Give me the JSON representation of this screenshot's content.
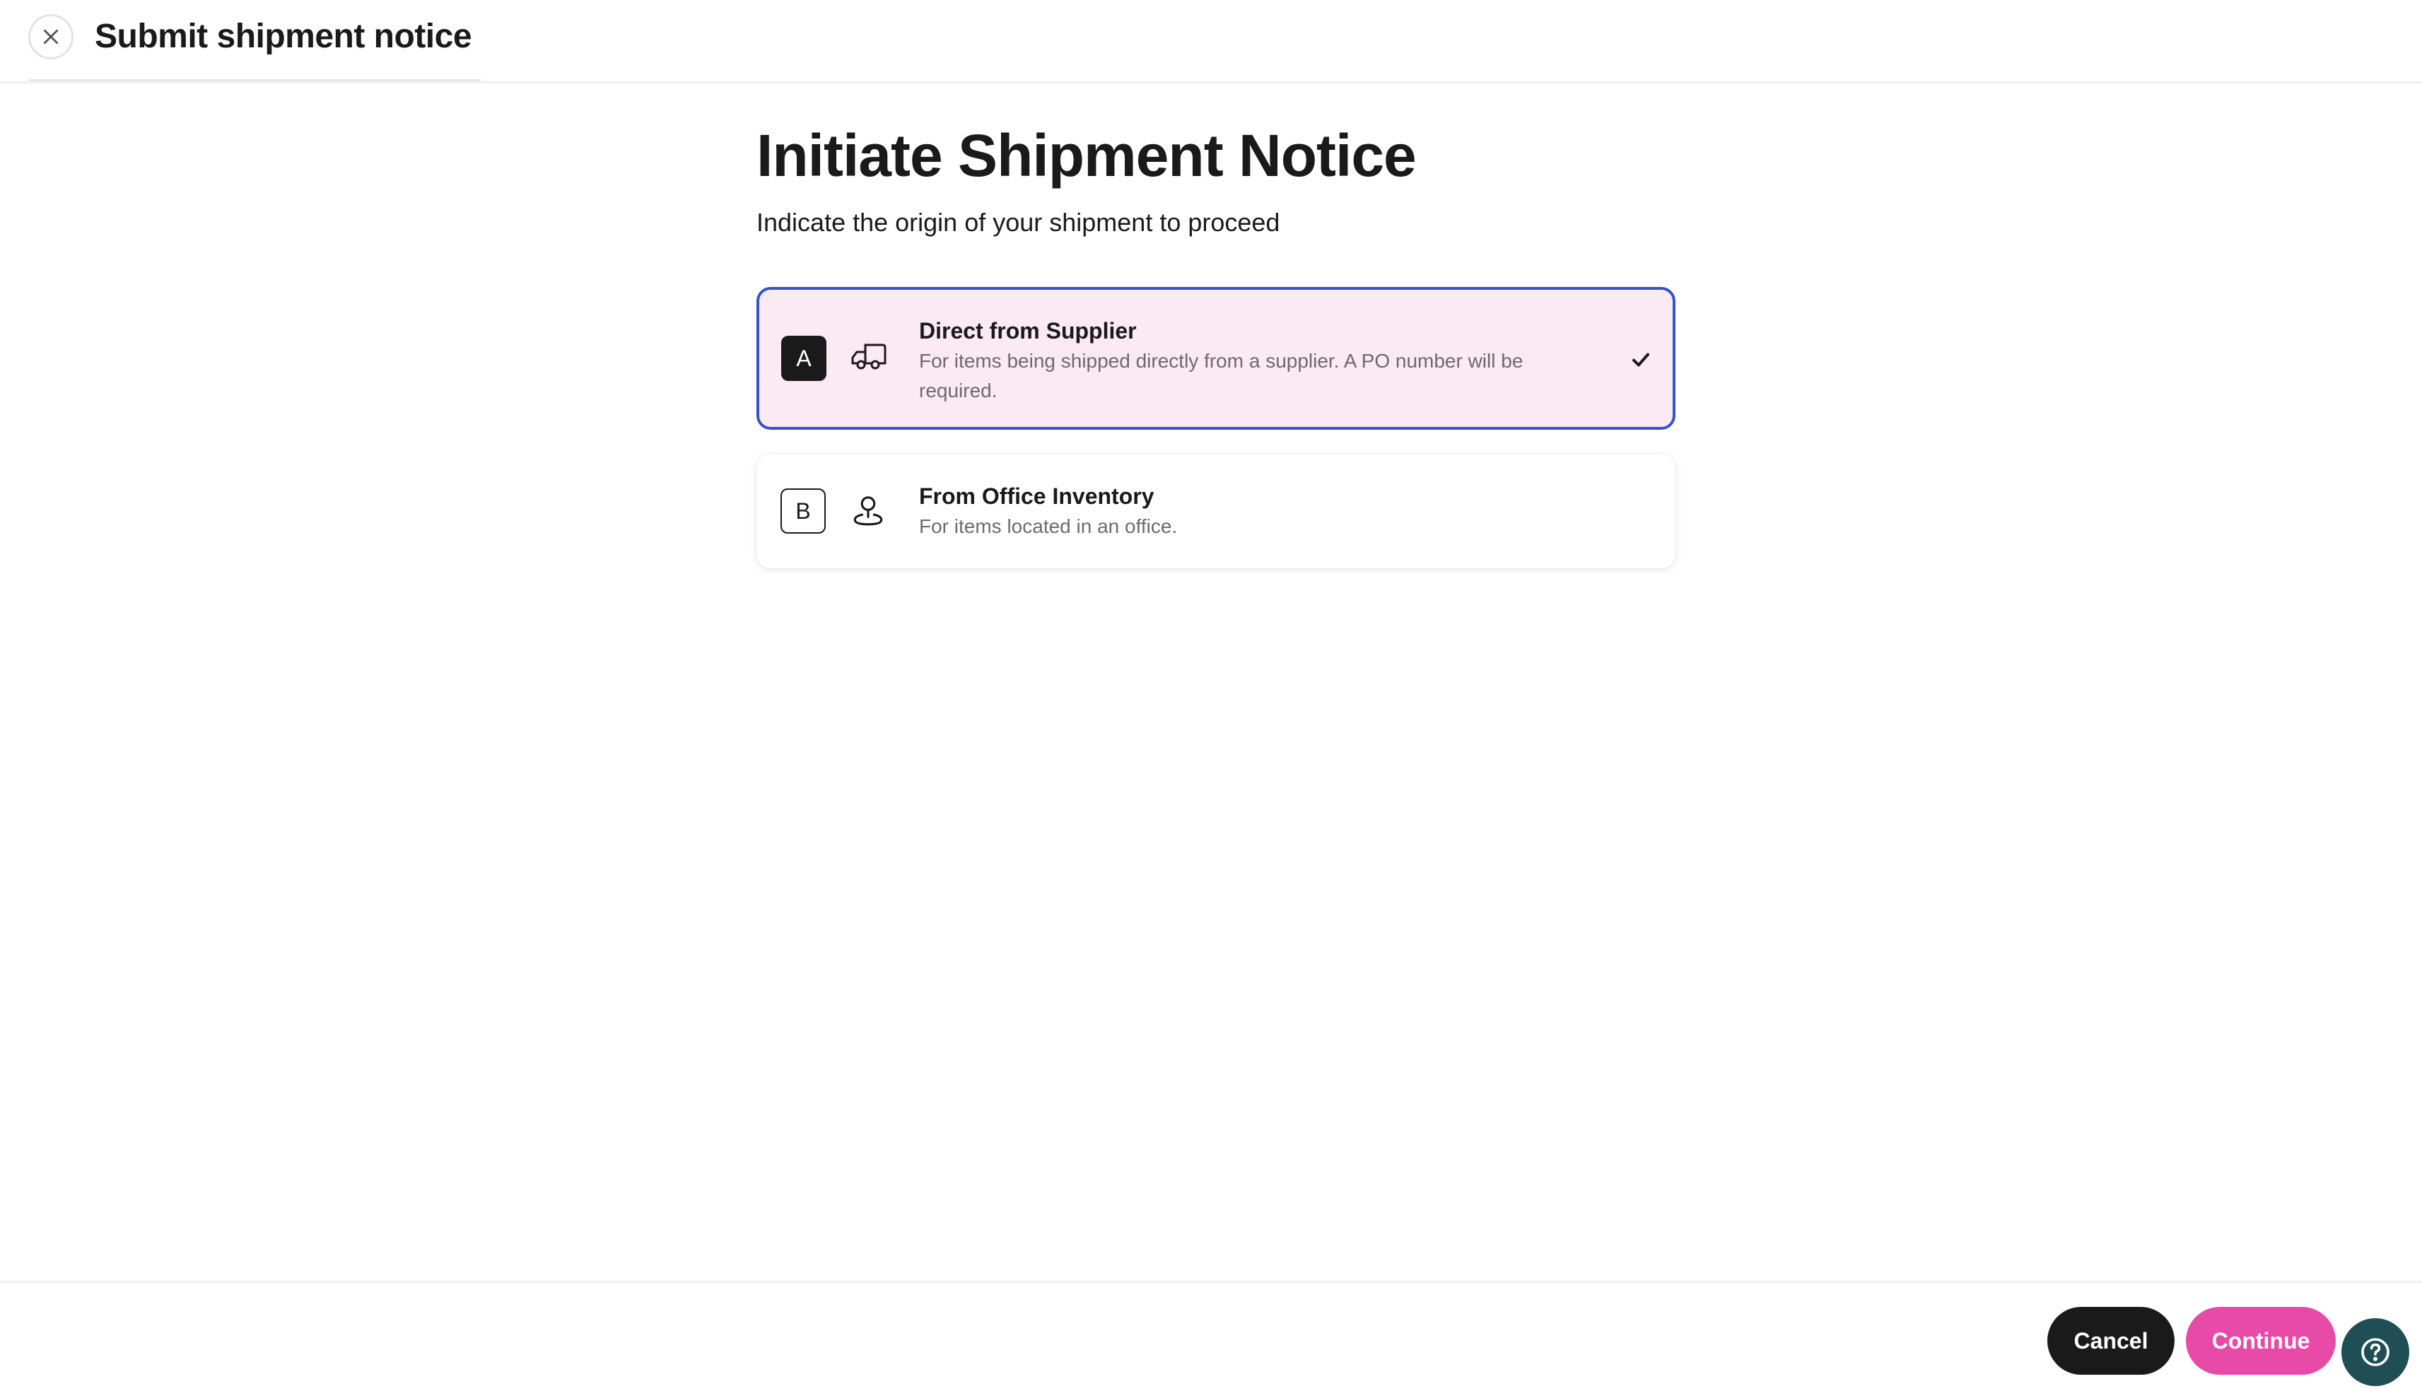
{
  "header": {
    "title": "Submit shipment notice",
    "close_icon": "close-icon"
  },
  "main": {
    "title": "Initiate Shipment Notice",
    "subtitle": "Indicate the origin of your shipment to proceed"
  },
  "options": [
    {
      "letter": "A",
      "icon": "truck-icon",
      "title": "Direct from Supplier",
      "description": "For items being shipped directly from a supplier. A PO number will be required.",
      "selected": true
    },
    {
      "letter": "B",
      "icon": "location-pin-icon",
      "title": "From Office Inventory",
      "description": "For items located in an office.",
      "selected": false
    }
  ],
  "footer": {
    "cancel_label": "Cancel",
    "continue_label": "Continue",
    "help_icon": "help-icon"
  },
  "colors": {
    "accent_pink": "#e84aa8",
    "selected_border": "#2f55c8",
    "selected_bg": "#fbe9f4",
    "help_bg": "#1f4f55"
  }
}
